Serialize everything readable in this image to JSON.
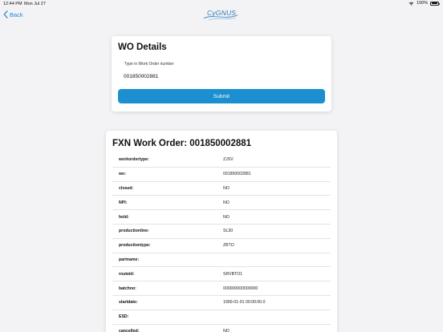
{
  "status_bar": {
    "time": "12:44 PM",
    "date": "Mon Jul 27",
    "battery": "100%"
  },
  "nav": {
    "back_label": "Back",
    "logo_text": "CyGNUS"
  },
  "wo_details": {
    "title": "WO Details",
    "input_label": "Type in Work Order number",
    "input_value": "001850002881",
    "submit_label": "Submit"
  },
  "work_order": {
    "title": "FXN Work Order: 001850002881",
    "rows": [
      {
        "key": "workordertype:",
        "value": "ZJSV"
      },
      {
        "key": "wo:",
        "value": "001850002881"
      },
      {
        "key": "closed:",
        "value": "NO"
      },
      {
        "key": "NPI:",
        "value": "NO"
      },
      {
        "key": "hold:",
        "value": "NO"
      },
      {
        "key": "productionline:",
        "value": "SL30"
      },
      {
        "key": "productiontype:",
        "value": "ZBTO"
      },
      {
        "key": "partname:",
        "value": ""
      },
      {
        "key": "routeid:",
        "value": "SRVBTO1"
      },
      {
        "key": "batchno:",
        "value": "000000000000000"
      },
      {
        "key": "startdate:",
        "value": "1900-01-01 00:00:00.0"
      },
      {
        "key": "ESD:",
        "value": ""
      },
      {
        "key": "cancelled:",
        "value": "NO"
      }
    ]
  },
  "colors": {
    "accent": "#1b8fd0",
    "link": "#1e86d6",
    "background": "#f3f3f5"
  }
}
